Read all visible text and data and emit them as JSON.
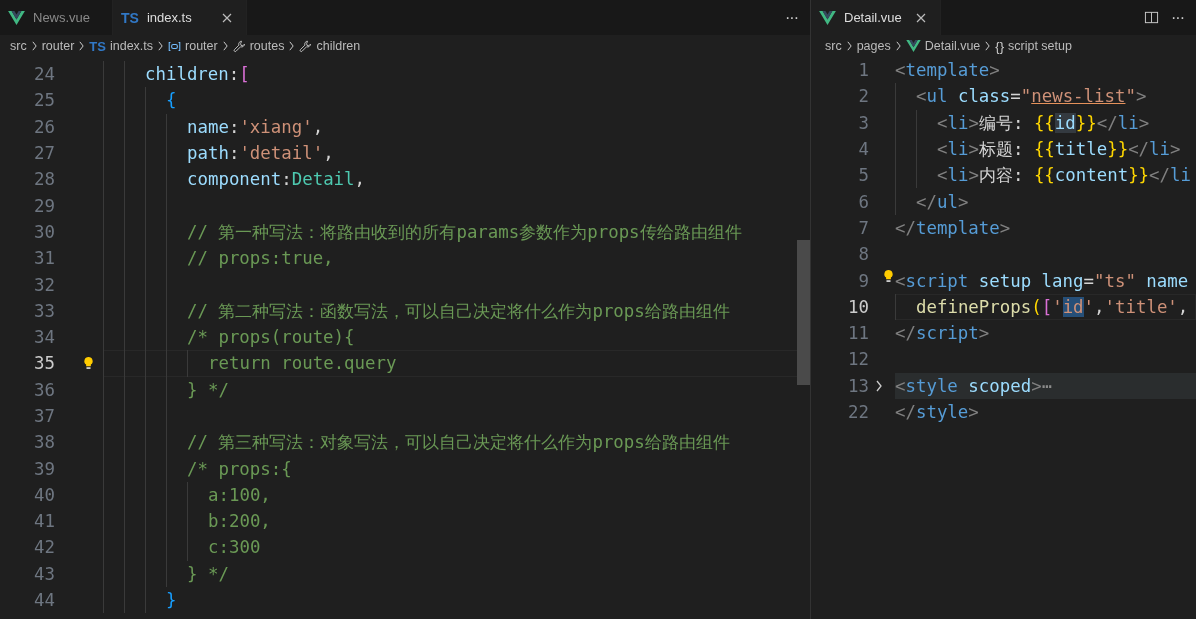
{
  "left_editor": {
    "tabs": [
      {
        "label": "News.vue",
        "kind": "vue",
        "selected": false,
        "closable": false
      },
      {
        "label": "index.ts",
        "kind": "ts",
        "badge": "TS",
        "selected": true,
        "closable": true
      }
    ],
    "more": "···",
    "breadcrumb": [
      {
        "kind": "folder",
        "label": "src"
      },
      {
        "kind": "folder",
        "label": "router"
      },
      {
        "kind": "ts",
        "badge": "TS",
        "label": "index.ts"
      },
      {
        "kind": "variable",
        "label": "router"
      },
      {
        "kind": "wrench",
        "label": "routes"
      },
      {
        "kind": "wrench",
        "label": "children"
      }
    ],
    "lines": [
      {
        "number": "24",
        "current": false,
        "lightbulb": false,
        "tokens": [
          {
            "kind": "key",
            "text": "children"
          },
          {
            "kind": "plain",
            "text": ":"
          },
          {
            "kind": "bracket",
            "text": "["
          }
        ],
        "children": [
          {
            "number": "25",
            "current": false,
            "lightbulb": false,
            "tokens": [
              {
                "kind": "brace",
                "text": "{"
              }
            ],
            "children": [
              {
                "number": "26",
                "current": false,
                "lightbulb": false,
                "tokens": [
                  {
                    "kind": "key",
                    "text": "name"
                  },
                  {
                    "kind": "plain",
                    "text": ":"
                  },
                  {
                    "kind": "string",
                    "text": "'xiang'"
                  },
                  {
                    "kind": "plain",
                    "text": ","
                  }
                ]
              },
              {
                "number": "27",
                "current": false,
                "lightbulb": false,
                "tokens": [
                  {
                    "kind": "key",
                    "text": "path"
                  },
                  {
                    "kind": "plain",
                    "text": ":"
                  },
                  {
                    "kind": "string",
                    "text": "'detail'"
                  },
                  {
                    "kind": "plain",
                    "text": ","
                  }
                ]
              },
              {
                "number": "28",
                "current": false,
                "lightbulb": false,
                "tokens": [
                  {
                    "kind": "key",
                    "text": "component"
                  },
                  {
                    "kind": "plain",
                    "text": ":"
                  },
                  {
                    "kind": "variable",
                    "text": "Detail"
                  },
                  {
                    "kind": "plain",
                    "text": ","
                  }
                ]
              },
              {
                "number": "29",
                "current": false,
                "lightbulb": false
              },
              {
                "number": "30",
                "current": false,
                "lightbulb": false,
                "tokens": [
                  {
                    "kind": "comment",
                    "text": "// 第一种写法：将路由收到的所有params参数作为props传给路由组件"
                  }
                ]
              },
              {
                "number": "31",
                "current": false,
                "lightbulb": false,
                "tokens": [
                  {
                    "kind": "comment",
                    "text": "// props:true,"
                  }
                ]
              },
              {
                "number": "32",
                "current": false,
                "lightbulb": false
              },
              {
                "number": "33",
                "current": false,
                "lightbulb": false,
                "tokens": [
                  {
                    "kind": "comment",
                    "text": "// 第二种写法：函数写法，可以自己决定将什么作为props给路由组件"
                  }
                ]
              },
              {
                "number": "34",
                "current": false,
                "lightbulb": false,
                "tokens": [
                  {
                    "kind": "comment",
                    "text": "/* props(route){"
                  }
                ],
                "children": [
                  {
                    "number": "35",
                    "current": true,
                    "lightbulb": true,
                    "tokens": [
                      {
                        "kind": "comment",
                        "text": "return route.query"
                      }
                    ]
                  }
                ]
              },
              {
                "number": "36",
                "current": false,
                "lightbulb": false,
                "tokens": [
                  {
                    "kind": "comment",
                    "text": "} */"
                  }
                ]
              },
              {
                "number": "37",
                "current": false,
                "lightbulb": false
              },
              {
                "number": "38",
                "current": false,
                "lightbulb": false,
                "tokens": [
                  {
                    "kind": "comment",
                    "text": "// 第三种写法：对象写法，可以自己决定将什么作为props给路由组件"
                  }
                ]
              },
              {
                "number": "39",
                "current": false,
                "lightbulb": false,
                "tokens": [
                  {
                    "kind": "comment",
                    "text": "/* props:{"
                  }
                ],
                "children": [
                  {
                    "number": "40",
                    "current": false,
                    "lightbulb": false,
                    "tokens": [
                      {
                        "kind": "comment",
                        "text": "a:100,"
                      }
                    ]
                  },
                  {
                    "number": "41",
                    "current": false,
                    "lightbulb": false,
                    "tokens": [
                      {
                        "kind": "comment",
                        "text": "b:200,"
                      }
                    ]
                  },
                  {
                    "number": "42",
                    "current": false,
                    "lightbulb": false,
                    "tokens": [
                      {
                        "kind": "comment",
                        "text": "c:300"
                      }
                    ]
                  }
                ]
              },
              {
                "number": "43",
                "current": false,
                "lightbulb": false,
                "tokens": [
                  {
                    "kind": "comment",
                    "text": "} */"
                  }
                ]
              }
            ]
          },
          {
            "number": "44",
            "current": false,
            "lightbulb": false,
            "tokens": [
              {
                "kind": "brace",
                "text": "}"
              }
            ]
          }
        ]
      }
    ]
  },
  "right_editor": {
    "tabs": [
      {
        "label": "Detail.vue",
        "kind": "vue",
        "selected": true,
        "closable": true
      }
    ],
    "more": "···",
    "breadcrumb": [
      {
        "kind": "folder",
        "label": "src"
      },
      {
        "kind": "folder",
        "label": "pages"
      },
      {
        "kind": "vue",
        "label": "Detail.vue"
      },
      {
        "kind": "braces",
        "badge": "{}",
        "label": "script setup"
      }
    ],
    "lines": [
      {
        "number": "1",
        "current": false,
        "lightbulb": false,
        "folded": false,
        "tokens": [
          {
            "kind": "angle",
            "text": "<"
          },
          {
            "kind": "tag",
            "text": "template"
          },
          {
            "kind": "angle",
            "text": ">"
          }
        ],
        "children": [
          {
            "number": "2",
            "current": false,
            "lightbulb": false,
            "folded": false,
            "tokens": [
              {
                "kind": "angle",
                "text": "<"
              },
              {
                "kind": "tag",
                "text": "ul"
              },
              {
                "kind": "key",
                "text": " class"
              },
              {
                "kind": "plain",
                "text": "="
              },
              {
                "kind": "string",
                "text": "\""
              },
              {
                "kind": "string-warn",
                "text": "news-list"
              },
              {
                "kind": "string",
                "text": "\""
              },
              {
                "kind": "angle",
                "text": ">"
              }
            ],
            "children": [
              {
                "number": "3",
                "current": false,
                "lightbulb": false,
                "folded": false,
                "tokens": [
                  {
                    "kind": "angle",
                    "text": "<"
                  },
                  {
                    "kind": "tag",
                    "text": "li"
                  },
                  {
                    "kind": "angle",
                    "text": ">"
                  },
                  {
                    "kind": "plain",
                    "text": "编号: "
                  },
                  {
                    "kind": "mustache",
                    "text": "{{"
                  },
                  {
                    "kind": "key-match",
                    "text": "id"
                  },
                  {
                    "kind": "mustache",
                    "text": "}}"
                  },
                  {
                    "kind": "angle",
                    "text": "</"
                  },
                  {
                    "kind": "tag",
                    "text": "li"
                  },
                  {
                    "kind": "angle",
                    "text": ">"
                  }
                ]
              },
              {
                "number": "4",
                "current": false,
                "lightbulb": false,
                "folded": false,
                "tokens": [
                  {
                    "kind": "angle",
                    "text": "<"
                  },
                  {
                    "kind": "tag",
                    "text": "li"
                  },
                  {
                    "kind": "angle",
                    "text": ">"
                  },
                  {
                    "kind": "plain",
                    "text": "标题: "
                  },
                  {
                    "kind": "mustache",
                    "text": "{{"
                  },
                  {
                    "kind": "key",
                    "text": "title"
                  },
                  {
                    "kind": "mustache",
                    "text": "}}"
                  },
                  {
                    "kind": "angle",
                    "text": "</"
                  },
                  {
                    "kind": "tag",
                    "text": "li"
                  },
                  {
                    "kind": "angle",
                    "text": ">"
                  }
                ]
              },
              {
                "number": "5",
                "current": false,
                "lightbulb": false,
                "folded": false,
                "tokens": [
                  {
                    "kind": "angle",
                    "text": "<"
                  },
                  {
                    "kind": "tag",
                    "text": "li"
                  },
                  {
                    "kind": "angle",
                    "text": ">"
                  },
                  {
                    "kind": "plain",
                    "text": "内容: "
                  },
                  {
                    "kind": "mustache",
                    "text": "{{"
                  },
                  {
                    "kind": "key",
                    "text": "content"
                  },
                  {
                    "kind": "mustache",
                    "text": "}}"
                  },
                  {
                    "kind": "angle",
                    "text": "</"
                  },
                  {
                    "kind": "tag",
                    "text": "li"
                  }
                ]
              }
            ]
          },
          {
            "number": "6",
            "current": false,
            "lightbulb": false,
            "folded": false,
            "tokens": [
              {
                "kind": "angle",
                "text": "</"
              },
              {
                "kind": "tag",
                "text": "ul"
              },
              {
                "kind": "angle",
                "text": ">"
              }
            ]
          }
        ]
      },
      {
        "number": "7",
        "current": false,
        "lightbulb": false,
        "folded": false,
        "tokens": [
          {
            "kind": "angle",
            "text": "</"
          },
          {
            "kind": "tag",
            "text": "template"
          },
          {
            "kind": "angle",
            "text": ">"
          }
        ]
      },
      {
        "number": "8",
        "current": false,
        "lightbulb": false,
        "folded": false
      },
      {
        "number": "9",
        "current": false,
        "lightbulb": true,
        "folded": false,
        "tokens": [
          {
            "kind": "angle",
            "text": "<"
          },
          {
            "kind": "tag",
            "text": "script"
          },
          {
            "kind": "key",
            "text": " setup"
          },
          {
            "kind": "key",
            "text": " lang"
          },
          {
            "kind": "plain",
            "text": "="
          },
          {
            "kind": "string",
            "text": "\"ts\""
          },
          {
            "kind": "key",
            "text": " name"
          }
        ],
        "children": [
          {
            "number": "10",
            "current": true,
            "lightbulb": false,
            "folded": false,
            "tokens": [
              {
                "kind": "function",
                "text": "defineProps"
              },
              {
                "kind": "brace-gold",
                "text": "("
              },
              {
                "kind": "bracket",
                "text": "["
              },
              {
                "kind": "string",
                "text": "'"
              },
              {
                "kind": "string-selected",
                "text": "id"
              },
              {
                "kind": "string",
                "text": "'"
              },
              {
                "kind": "plain",
                "text": ","
              },
              {
                "kind": "string",
                "text": "'title'"
              },
              {
                "kind": "plain",
                "text": ","
              }
            ]
          }
        ]
      },
      {
        "number": "11",
        "current": false,
        "lightbulb": false,
        "folded": false,
        "tokens": [
          {
            "kind": "angle",
            "text": "</"
          },
          {
            "kind": "tag",
            "text": "script"
          },
          {
            "kind": "angle",
            "text": ">"
          }
        ]
      },
      {
        "number": "12",
        "current": false,
        "lightbulb": false,
        "folded": false
      },
      {
        "number": "13",
        "current": false,
        "lightbulb": false,
        "folded": true,
        "tokens": [
          {
            "kind": "angle",
            "text": "<"
          },
          {
            "kind": "tag",
            "text": "style"
          },
          {
            "kind": "key",
            "text": " scoped"
          },
          {
            "kind": "angle",
            "text": ">"
          },
          {
            "kind": "fold",
            "text": "⋯"
          }
        ]
      },
      {
        "number": "22",
        "current": false,
        "lightbulb": false,
        "folded": false,
        "tokens": [
          {
            "kind": "angle",
            "text": "</"
          },
          {
            "kind": "tag",
            "text": "style"
          },
          {
            "kind": "angle",
            "text": ">"
          }
        ]
      }
    ]
  }
}
